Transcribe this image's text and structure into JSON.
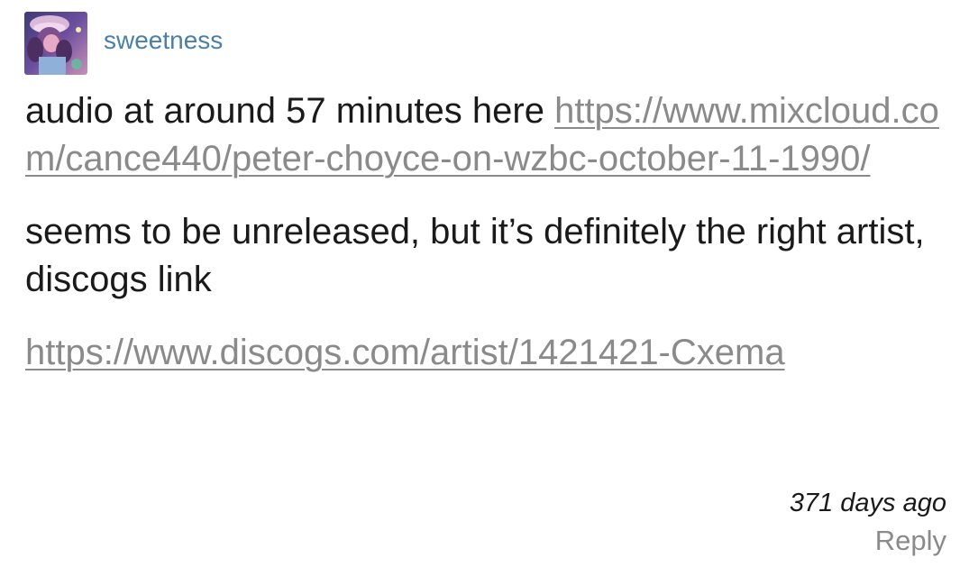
{
  "comment": {
    "author": {
      "username": "sweetness",
      "avatar_icon": "user-avatar-image"
    },
    "body": {
      "paragraph1_text": "audio at around 57 minutes here ",
      "paragraph1_link": "https://www.mixcloud.com/cance440/peter-choyce-on-wzbc-october-11-1990/",
      "paragraph2_text": "seems to be unreleased, but it’s definitely the right artist, discogs link",
      "paragraph3_link": "https://www.discogs.com/artist/1421421-Cxema"
    },
    "footer": {
      "timestamp": "371 days ago",
      "reply_label": "Reply"
    },
    "colors": {
      "username": "#4a7fa6",
      "link": "#8a8a8a",
      "text": "#1a1a1a",
      "background": "#ffffff"
    }
  }
}
